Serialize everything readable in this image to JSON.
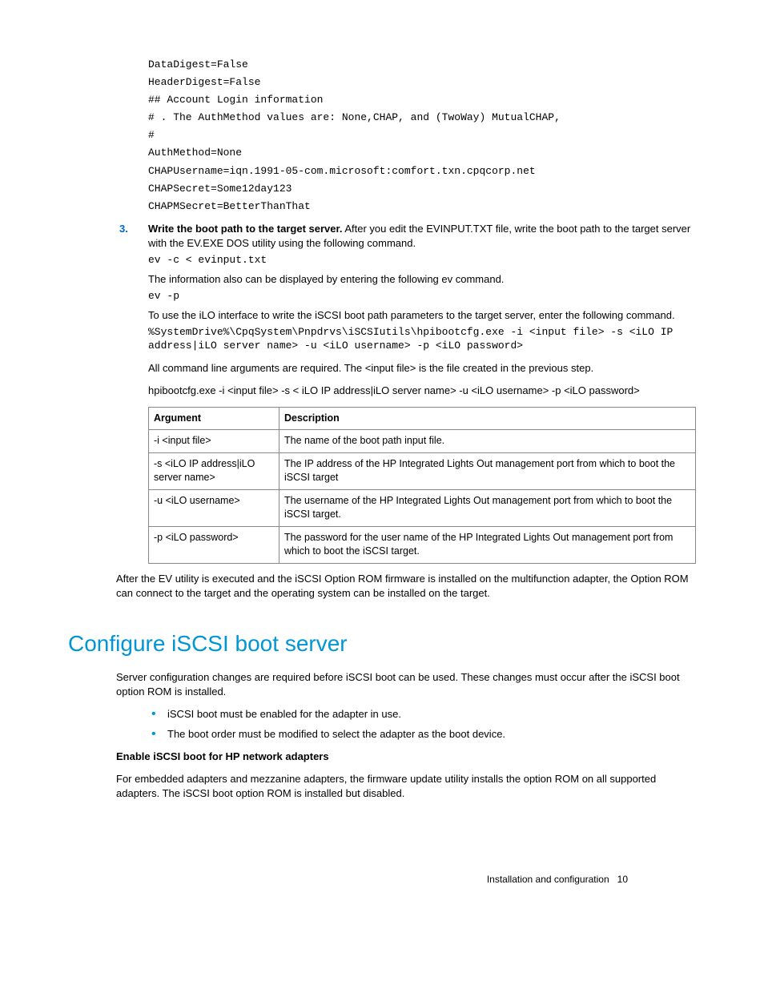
{
  "codeblock1": "DataDigest=False\nHeaderDigest=False\n## Account Login information\n# . The AuthMethod values are: None,CHAP, and (TwoWay) MutualCHAP,\n#\nAuthMethod=None\nCHAPUsername=iqn.1991-05-com.microsoft:comfort.txn.cpqcorp.net\nCHAPSecret=Some12day123\nCHAPMSecret=BetterThanThat",
  "step3": {
    "num": "3.",
    "bold": "Write the boot path to the target server.",
    "rest": " After you edit the EVINPUT.TXT file, write the boot path to the target server with the EV.EXE DOS utility using the following command."
  },
  "code2": "ev -c < evinput.txt",
  "para1": "The information also can be displayed by entering the following ev command.",
  "code3": "ev -p",
  "para2": "To use the iLO interface to write the iSCSI boot path parameters to the target server, enter the following command.",
  "code4": "%SystemDrive%\\CpqSystem\\Pnpdrvs\\iSCSIutils\\hpibootcfg.exe -i <input file> -s <iLO IP address|iLO server name> -u <iLO username> -p <iLO password>",
  "para3": "All command line arguments are required. The <input file> is the file created in the previous step.",
  "para4": "hpibootcfg.exe -i <input file> -s < iLO IP address|iLO server name> -u <iLO username> -p <iLO password>",
  "table": {
    "headers": {
      "arg": "Argument",
      "desc": "Description"
    },
    "rows": [
      {
        "arg": "-i <input file>",
        "desc": "The name of the boot path input file."
      },
      {
        "arg": "-s <iLO IP address|iLO server name>",
        "desc": "The IP address of the HP Integrated Lights Out management port from which to boot the iSCSI target"
      },
      {
        "arg": "-u <iLO username>",
        "desc": "The username of the HP Integrated Lights Out management port from which to boot the iSCSI target."
      },
      {
        "arg": "-p <iLO password>",
        "desc": "The password for the user name of the HP Integrated Lights Out management port from which to boot the iSCSI target."
      }
    ]
  },
  "para5": "After the EV utility is executed and the iSCSI Option ROM firmware is installed on the multifunction adapter, the Option ROM can connect to the target and the operating system can be installed on the target.",
  "heading": "Configure iSCSI boot server",
  "para6": "Server configuration changes are required before iSCSI boot can be used. These changes must occur after the iSCSI boot option ROM is installed.",
  "bullets": [
    "iSCSI boot must be enabled for the adapter in use.",
    "The boot order must be modified to select the adapter as the boot device."
  ],
  "subheading": "Enable iSCSI boot for HP network adapters",
  "para7": "For embedded adapters and mezzanine adapters, the firmware update utility installs the option ROM on all supported adapters. The iSCSI boot option ROM is installed but disabled.",
  "footer": {
    "section": "Installation and configuration",
    "page": "10"
  }
}
